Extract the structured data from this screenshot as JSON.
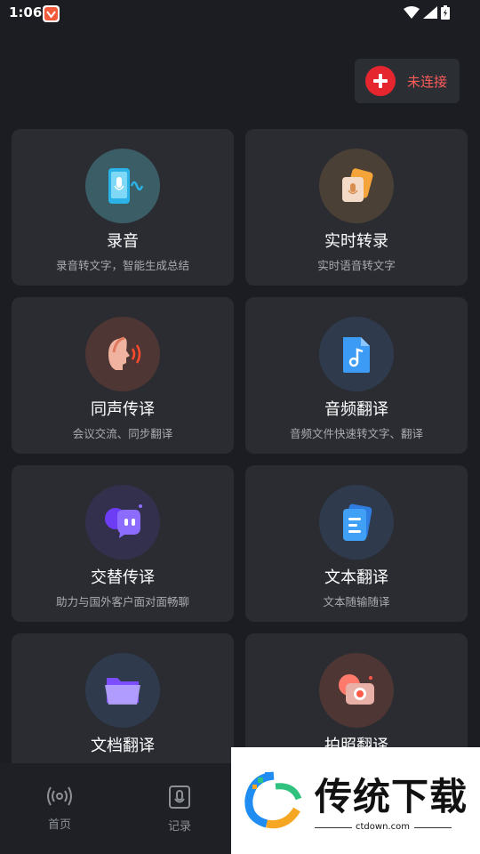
{
  "status_bar": {
    "time": "1:06"
  },
  "connect_button": {
    "label": "未连接"
  },
  "cards": [
    {
      "title": "录音",
      "desc": "录音转文字，智能生成总结",
      "icon": "recording-phone-icon"
    },
    {
      "title": "实时转录",
      "desc": "实时语音转文字",
      "icon": "realtime-transcribe-icon"
    },
    {
      "title": "同声传译",
      "desc": "会议交流、同步翻译",
      "icon": "simultaneous-interpret-icon"
    },
    {
      "title": "音频翻译",
      "desc": "音频文件快速转文字、翻译",
      "icon": "audio-file-icon"
    },
    {
      "title": "交替传译",
      "desc": "助力与国外客户面对面畅聊",
      "icon": "chat-bubbles-icon"
    },
    {
      "title": "文本翻译",
      "desc": "文本随输随译",
      "icon": "text-document-icon"
    },
    {
      "title": "文档翻译",
      "desc": "",
      "icon": "folder-icon"
    },
    {
      "title": "拍照翻译",
      "desc": "",
      "icon": "camera-icon"
    }
  ],
  "bottom_nav": [
    {
      "label": "首页",
      "icon": "broadcast-icon"
    },
    {
      "label": "记录",
      "icon": "record-clip-icon"
    }
  ],
  "watermark": {
    "text": "传统下载",
    "url": "ctdown.com"
  },
  "colors": {
    "background": "#1b1d22",
    "card": "#2a2c32",
    "accent_red": "#e5262f"
  }
}
